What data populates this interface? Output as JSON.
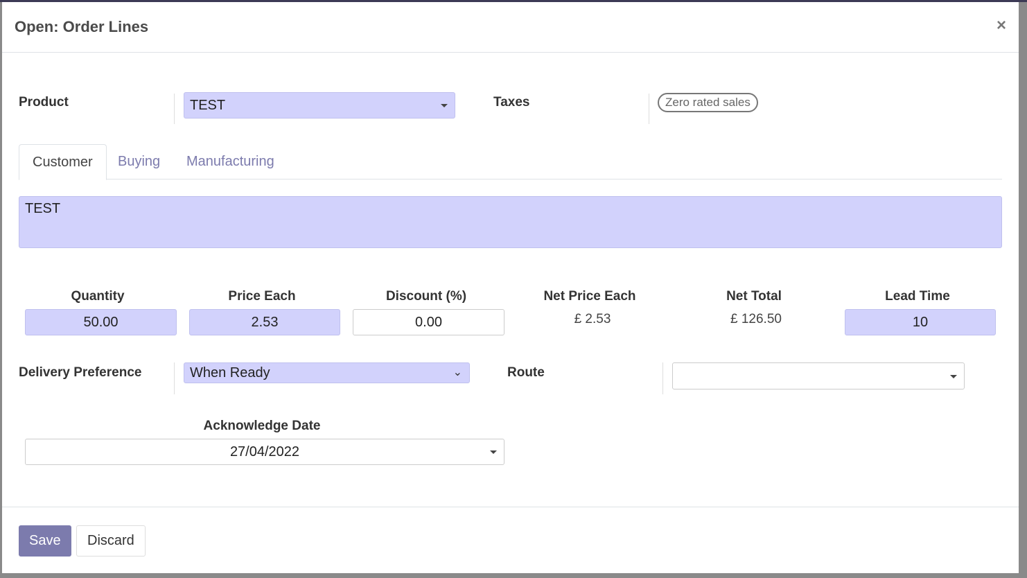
{
  "dialog": {
    "title": "Open: Order Lines",
    "close_label": "×"
  },
  "product": {
    "label": "Product",
    "value": "TEST"
  },
  "taxes": {
    "label": "Taxes",
    "tag": "Zero rated sales"
  },
  "tabs": [
    {
      "label": "Customer",
      "active": true
    },
    {
      "label": "Buying"
    },
    {
      "label": "Manufacturing"
    }
  ],
  "description": "TEST",
  "pricing": {
    "quantity": {
      "label": "Quantity",
      "value": "50.00"
    },
    "price_each": {
      "label": "Price Each",
      "value": "2.53"
    },
    "discount": {
      "label": "Discount (%)",
      "value": "0.00"
    },
    "net_price_each": {
      "label": "Net Price Each",
      "value": "£ 2.53"
    },
    "net_total": {
      "label": "Net Total",
      "value": "£ 126.50"
    },
    "lead_time": {
      "label": "Lead Time",
      "value": "10"
    }
  },
  "delivery": {
    "label": "Delivery Preference",
    "value": "When Ready"
  },
  "route": {
    "label": "Route",
    "value": ""
  },
  "ack": {
    "label": "Acknowledge Date",
    "value": "27/04/2022"
  },
  "footer": {
    "save": "Save",
    "discard": "Discard"
  },
  "colors": {
    "accent": "#7c7bad",
    "input_bg": "#d2d2fc"
  }
}
